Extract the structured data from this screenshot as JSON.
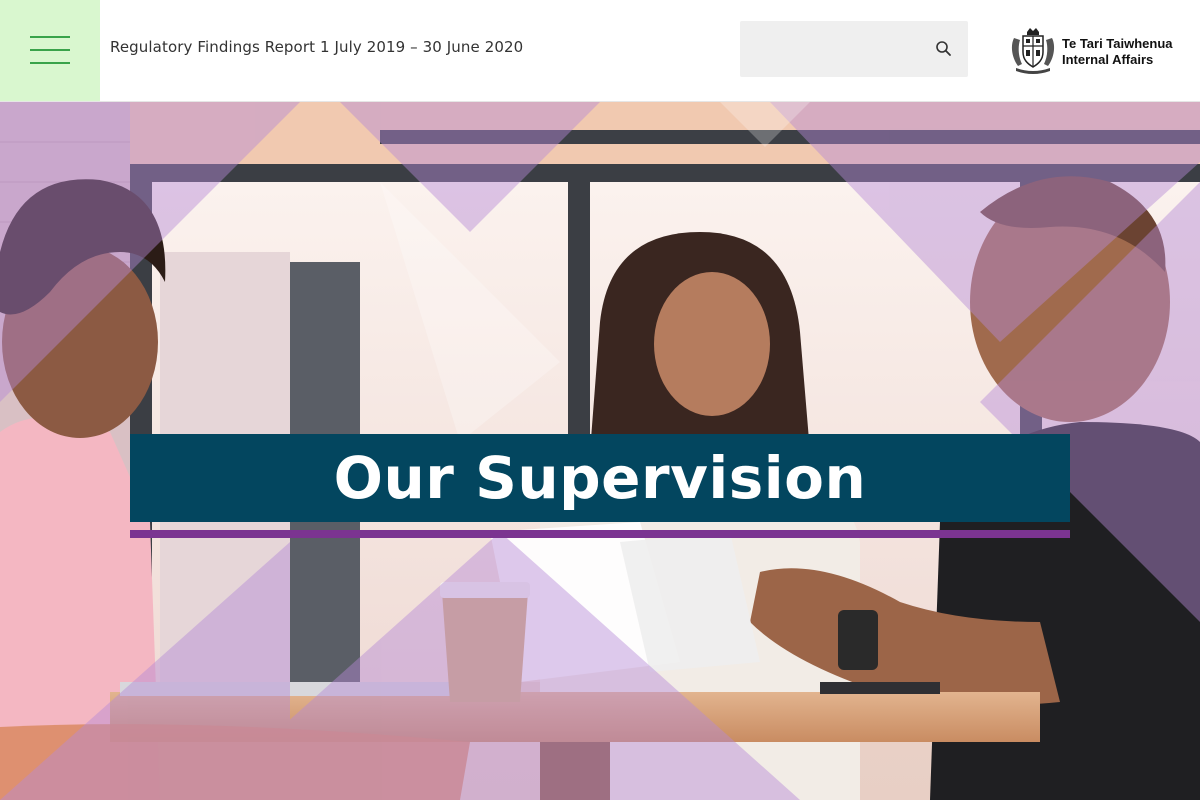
{
  "header": {
    "menu_icon": "hamburger-menu-icon",
    "report_title": "Regulatory Findings Report 1 July 2019 – 30 June 2020",
    "search": {
      "placeholder": "",
      "icon": "search-icon"
    },
    "logo": {
      "crest_icon": "nz-coat-of-arms-crest",
      "line1": "Te Tari Taiwhenua",
      "line2": "Internal Affairs"
    }
  },
  "hero": {
    "title": "Our Supervision",
    "image_description_icon": "office-meeting-photo",
    "colors": {
      "banner": "#03465f",
      "underline": "#7b3491",
      "overlay": "#b58ad6",
      "menu_bg": "#d9f7cf",
      "menu_bars": "#39a34a"
    }
  }
}
